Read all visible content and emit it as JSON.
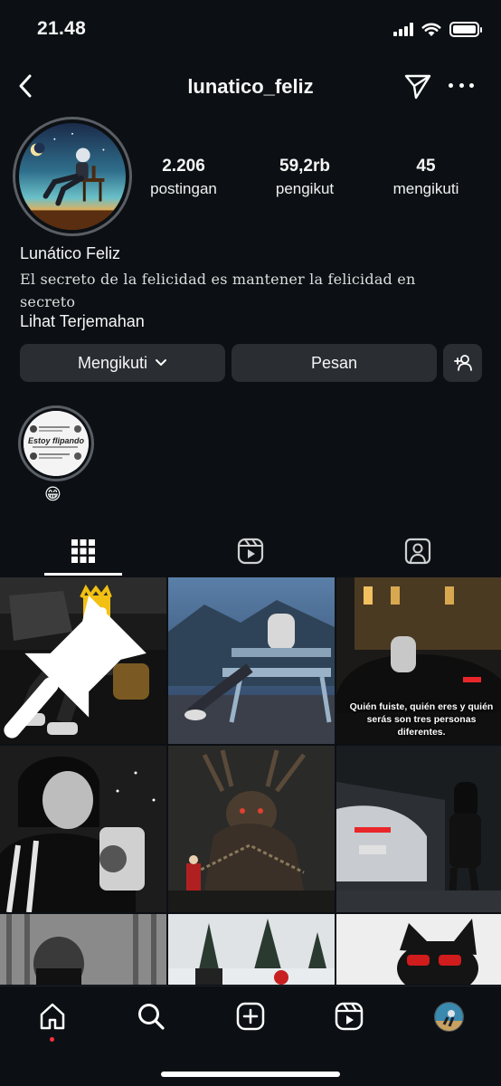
{
  "status_bar": {
    "time": "21.48",
    "icons": [
      "cellular-signal-icon",
      "wifi-icon",
      "battery-icon"
    ],
    "battery_level": 1.0
  },
  "header": {
    "username": "lunatico_feliz",
    "icons": [
      "back-chevron-icon",
      "send-icon",
      "more-icon"
    ]
  },
  "profile": {
    "stats": [
      {
        "value": "2.206",
        "label": "postingan"
      },
      {
        "value": "59,2rb",
        "label": "pengikut"
      },
      {
        "value": "45",
        "label": "mengikuti"
      }
    ],
    "display_name": "Lunático Feliz",
    "bio": "El secreto de la felicidad es mantener la felicidad en secreto",
    "translate_link": "Lihat Terjemahan"
  },
  "actions": {
    "follow_label": "Mengikuti",
    "message_label": "Pesan",
    "icons": [
      "chevron-down-icon",
      "add-person-icon"
    ]
  },
  "highlights": [
    {
      "label": "😁",
      "thumb_title": "Estoy flipando"
    }
  ],
  "tabs": [
    {
      "name": "posts-grid",
      "icon": "grid-icon",
      "active": true
    },
    {
      "name": "reels",
      "icon": "reels-icon",
      "active": false
    },
    {
      "name": "tagged",
      "icon": "tagged-person-icon",
      "active": false
    }
  ],
  "posts": [
    {
      "pinned": true,
      "caption": ""
    },
    {
      "pinned": false,
      "caption": ""
    },
    {
      "pinned": false,
      "caption": "Quién fuiste, quién eres y quién serás son tres personas diferentes."
    },
    {
      "pinned": false,
      "caption": ""
    },
    {
      "pinned": false,
      "caption": ""
    },
    {
      "pinned": false,
      "caption": ""
    },
    {
      "pinned": false,
      "caption": ""
    },
    {
      "pinned": false,
      "caption": ""
    },
    {
      "pinned": false,
      "caption": ""
    }
  ],
  "bottom_nav": {
    "items": [
      "home-icon",
      "search-icon",
      "create-icon",
      "reels-icon",
      "profile-avatar"
    ],
    "active": "home",
    "home_notification_dot": true
  },
  "colors": {
    "background": "#0c1014",
    "button": "#2a2e33",
    "text": "#f5f5f5",
    "notification": "#ff3040"
  }
}
